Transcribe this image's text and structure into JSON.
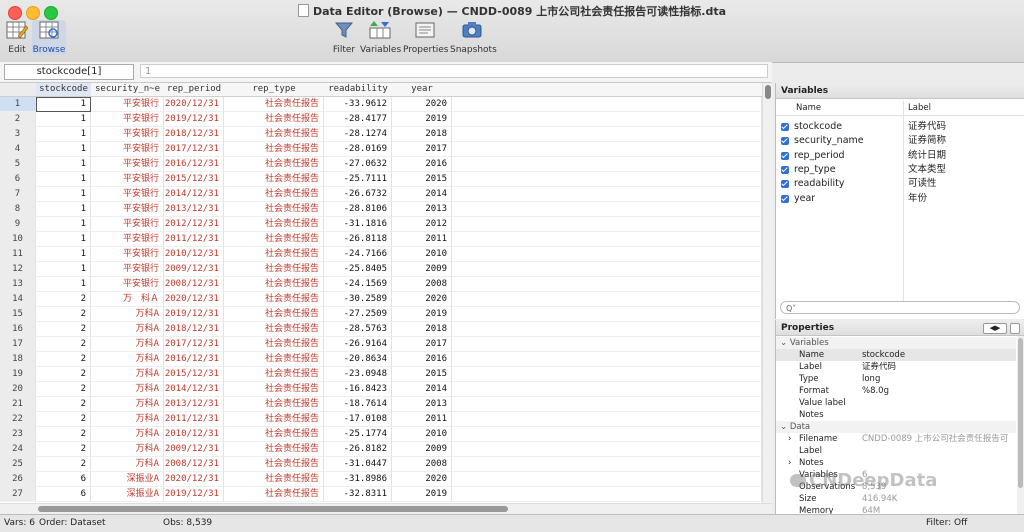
{
  "window": {
    "title": "Data Editor (Browse) — CNDD-0089 上市公司社会责任报告可读性指标.dta"
  },
  "toolbar": {
    "edit": "Edit",
    "browse": "Browse",
    "filter": "Filter",
    "variables": "Variables",
    "properties": "Properties",
    "snapshots": "Snapshots"
  },
  "cell_ref": {
    "name": "stockcode[1]",
    "value": "1"
  },
  "grid": {
    "columns": [
      "stockcode",
      "security_n~e",
      "rep_period",
      "rep_type",
      "readability",
      "year"
    ],
    "rows": [
      [
        "1",
        "1",
        "平安银行",
        "2020/12/31",
        "社会责任报告",
        "-33.9612",
        "2020"
      ],
      [
        "2",
        "1",
        "平安银行",
        "2019/12/31",
        "社会责任报告",
        "-28.4177",
        "2019"
      ],
      [
        "3",
        "1",
        "平安银行",
        "2018/12/31",
        "社会责任报告",
        "-28.1274",
        "2018"
      ],
      [
        "4",
        "1",
        "平安银行",
        "2017/12/31",
        "社会责任报告",
        "-28.0169",
        "2017"
      ],
      [
        "5",
        "1",
        "平安银行",
        "2016/12/31",
        "社会责任报告",
        "-27.0632",
        "2016"
      ],
      [
        "6",
        "1",
        "平安银行",
        "2015/12/31",
        "社会责任报告",
        "-25.7111",
        "2015"
      ],
      [
        "7",
        "1",
        "平安银行",
        "2014/12/31",
        "社会责任报告",
        "-26.6732",
        "2014"
      ],
      [
        "8",
        "1",
        "平安银行",
        "2013/12/31",
        "社会责任报告",
        "-28.8106",
        "2013"
      ],
      [
        "9",
        "1",
        "平安银行",
        "2012/12/31",
        "社会责任报告",
        "-31.1816",
        "2012"
      ],
      [
        "10",
        "1",
        "平安银行",
        "2011/12/31",
        "社会责任报告",
        "-26.8118",
        "2011"
      ],
      [
        "11",
        "1",
        "平安银行",
        "2010/12/31",
        "社会责任报告",
        "-24.7166",
        "2010"
      ],
      [
        "12",
        "1",
        "平安银行",
        "2009/12/31",
        "社会责任报告",
        "-25.8405",
        "2009"
      ],
      [
        "13",
        "1",
        "平安银行",
        "2008/12/31",
        "社会责任报告",
        "-24.1569",
        "2008"
      ],
      [
        "14",
        "2",
        "万　科Ａ",
        "2020/12/31",
        "社会责任报告",
        "-30.2589",
        "2020"
      ],
      [
        "15",
        "2",
        "万科A",
        "2019/12/31",
        "社会责任报告",
        "-27.2509",
        "2019"
      ],
      [
        "16",
        "2",
        "万科A",
        "2018/12/31",
        "社会责任报告",
        "-28.5763",
        "2018"
      ],
      [
        "17",
        "2",
        "万科A",
        "2017/12/31",
        "社会责任报告",
        "-26.9164",
        "2017"
      ],
      [
        "18",
        "2",
        "万科A",
        "2016/12/31",
        "社会责任报告",
        "-20.8634",
        "2016"
      ],
      [
        "19",
        "2",
        "万科A",
        "2015/12/31",
        "社会责任报告",
        "-23.0948",
        "2015"
      ],
      [
        "20",
        "2",
        "万科A",
        "2014/12/31",
        "社会责任报告",
        "-16.8423",
        "2014"
      ],
      [
        "21",
        "2",
        "万科A",
        "2013/12/31",
        "社会责任报告",
        "-18.7614",
        "2013"
      ],
      [
        "22",
        "2",
        "万科A",
        "2011/12/31",
        "社会责任报告",
        "-17.0108",
        "2011"
      ],
      [
        "23",
        "2",
        "万科A",
        "2010/12/31",
        "社会责任报告",
        "-25.1774",
        "2010"
      ],
      [
        "24",
        "2",
        "万科A",
        "2009/12/31",
        "社会责任报告",
        "-26.8182",
        "2009"
      ],
      [
        "25",
        "2",
        "万科A",
        "2008/12/31",
        "社会责任报告",
        "-31.0447",
        "2008"
      ],
      [
        "26",
        "6",
        "深振业A",
        "2020/12/31",
        "社会责任报告",
        "-31.8986",
        "2020"
      ],
      [
        "27",
        "6",
        "深振业A",
        "2019/12/31",
        "社会责任报告",
        "-32.8311",
        "2019"
      ]
    ]
  },
  "variables_panel": {
    "title": "Variables",
    "col_name": "Name",
    "col_label": "Label",
    "items": [
      {
        "name": "stockcode",
        "label": "证券代码"
      },
      {
        "name": "security_name",
        "label": "证券简称"
      },
      {
        "name": "rep_period",
        "label": "统计日期"
      },
      {
        "name": "rep_type",
        "label": "文本类型"
      },
      {
        "name": "readability",
        "label": "可读性"
      },
      {
        "name": "year",
        "label": "年份"
      }
    ],
    "search_placeholder": "Q˅"
  },
  "properties_panel": {
    "title": "Properties",
    "sections": {
      "variables": "Variables",
      "data": "Data"
    },
    "var_props": [
      {
        "k": "Name",
        "v": "stockcode"
      },
      {
        "k": "Label",
        "v": "证券代码"
      },
      {
        "k": "Type",
        "v": "long"
      },
      {
        "k": "Format",
        "v": "%8.0g"
      },
      {
        "k": "Value label",
        "v": ""
      },
      {
        "k": "Notes",
        "v": ""
      }
    ],
    "data_props": [
      {
        "k": "Filename",
        "v": "CNDD-0089 上市公司社会责任报告可"
      },
      {
        "k": "Label",
        "v": ""
      },
      {
        "k": "Notes",
        "v": ""
      },
      {
        "k": "Variables",
        "v": "6"
      },
      {
        "k": "Observations",
        "v": "8,539"
      },
      {
        "k": "Size",
        "v": "416.94K"
      },
      {
        "k": "Memory",
        "v": "64M"
      }
    ]
  },
  "status": {
    "vars": "Vars: 6",
    "order": "Order: Dataset",
    "obs": "Obs: 8,539",
    "filter": "Filter: Off"
  },
  "watermark": "CNDeepData"
}
